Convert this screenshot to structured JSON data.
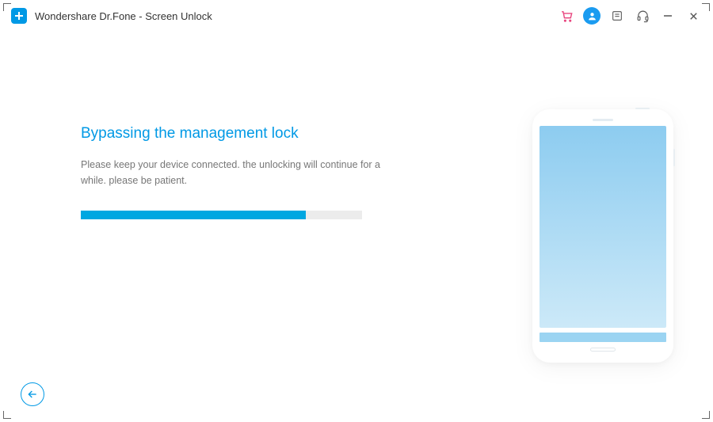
{
  "app": {
    "title": "Wondershare Dr.Fone - Screen Unlock"
  },
  "titlebar_icons": {
    "cart": "cart-icon",
    "user": "user-icon",
    "feedback": "feedback-icon",
    "support": "support-icon",
    "minimize": "minimize-icon",
    "close": "close-icon"
  },
  "main": {
    "heading": "Bypassing the management lock",
    "description": "Please keep your device connected. the unlocking will continue for a while. please be patient.",
    "progress_percent": 80
  },
  "colors": {
    "brand": "#0099e5",
    "progress": "#00a7e1",
    "cart": "#e8467f"
  }
}
